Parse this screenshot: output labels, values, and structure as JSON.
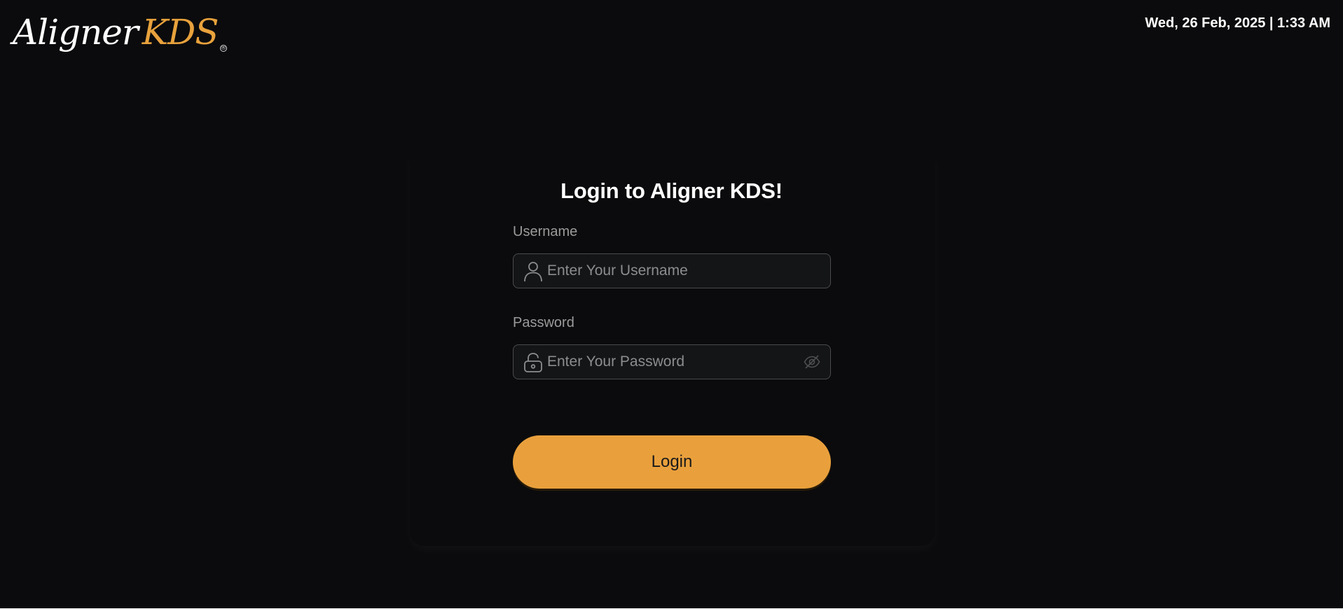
{
  "header": {
    "logo_word_a": "Aligner",
    "logo_word_b": "KDS",
    "logo_registered": "®",
    "datetime": "Wed, 26 Feb, 2025 | 1:33 AM"
  },
  "login": {
    "title": "Login to Aligner KDS!",
    "username_label": "Username",
    "username_placeholder": "Enter Your Username",
    "username_value": "",
    "password_label": "Password",
    "password_placeholder": "Enter Your Password",
    "password_value": "",
    "submit_label": "Login"
  },
  "icons": {
    "username": "user-icon",
    "password": "lock-icon",
    "toggle": "eye-off-icon"
  },
  "colors": {
    "background": "#0b0b0d",
    "accent": "#e9a03c",
    "field_background": "#141516",
    "field_border": "#4a4b4d"
  }
}
